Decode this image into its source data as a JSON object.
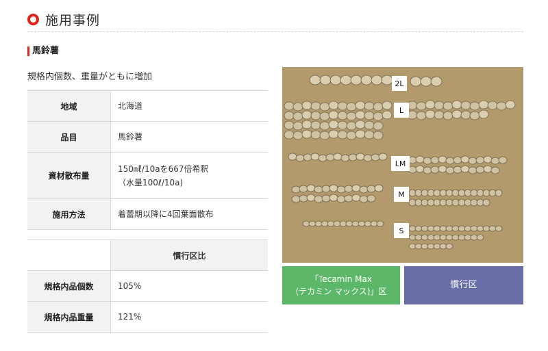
{
  "section": {
    "title": "施用事例",
    "icon": "ring-icon",
    "accent": "#e2231a"
  },
  "crop_heading": "馬鈴薯",
  "lead_text": "規格内個数、重量がともに増加",
  "details": [
    {
      "label": "地域",
      "value_lines": [
        "北海道"
      ]
    },
    {
      "label": "品目",
      "value_lines": [
        "馬鈴薯"
      ]
    },
    {
      "label": "資材散布量",
      "value_lines": [
        "150㎖/10aを667倍希釈",
        "（水量100ℓ/10a)"
      ]
    },
    {
      "label": "施用方法",
      "value_lines": [
        "着蕾期以降に4回葉面散布"
      ]
    }
  ],
  "comparison": {
    "column_header": "慣行区比",
    "rows": [
      {
        "label": "規格内品個数",
        "value": "105%"
      },
      {
        "label": "規格内品重量",
        "value": "121%"
      }
    ]
  },
  "photo": {
    "size_labels": [
      "2L",
      "L",
      "LM",
      "M",
      "S"
    ]
  },
  "captions": {
    "tecamin": [
      "「Tecamin Max",
      "(テカミン マックス)」区"
    ],
    "tecamin_color": "#5db769",
    "conventional": "慣行区",
    "conventional_color": "#6a6ea8"
  }
}
